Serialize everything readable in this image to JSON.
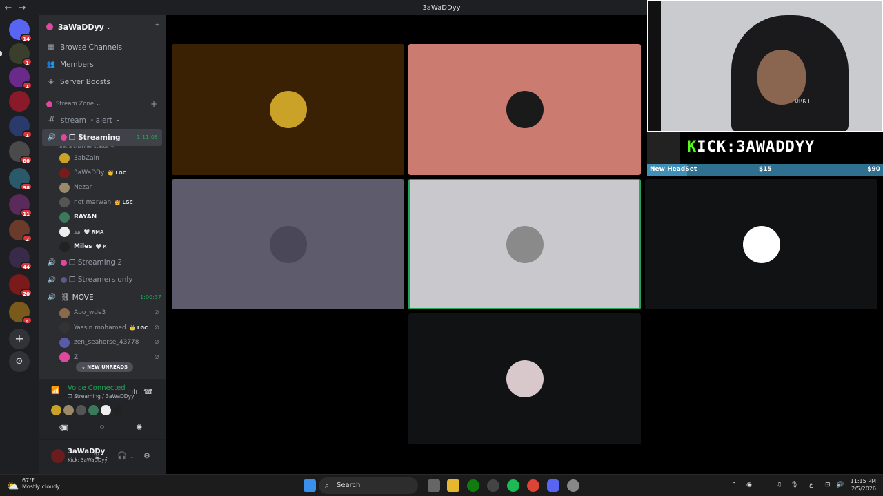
{
  "window": {
    "title": "3aWaDDyy",
    "back": "←",
    "forward": "→"
  },
  "rail": {
    "servers": [
      {
        "name": "home",
        "color": "#5865f2",
        "badge": "14",
        "y": 0
      },
      {
        "name": "s1",
        "color": "#3a3f2d",
        "badge": "1"
      },
      {
        "name": "s2",
        "color": "#6a2a8a",
        "badge": "1"
      },
      {
        "name": "s3",
        "color": "#8a1a2a",
        "badge": ""
      },
      {
        "name": "s4",
        "color": "#2a3a6a",
        "badge": "1"
      },
      {
        "name": "s5",
        "color": "#4a4a4a",
        "badge": "80"
      },
      {
        "name": "s6",
        "color": "#2a5a6a",
        "badge": "98"
      },
      {
        "name": "s7",
        "color": "#5a2a5a",
        "badge": "11"
      },
      {
        "name": "s8",
        "color": "#6a3a2a",
        "badge": "2"
      },
      {
        "name": "s9",
        "color": "#3a2a4a",
        "badge": "44"
      },
      {
        "name": "s10",
        "color": "#7a1a1a",
        "badge": "20"
      },
      {
        "name": "s11",
        "color": "#7a5a1a",
        "badge": "4"
      }
    ],
    "add_label": "+",
    "discover_label": "⊙"
  },
  "guild": {
    "name": "3aWaDDyy",
    "chevron": "⌄",
    "invite": "⁺"
  },
  "nav": [
    {
      "icon": "▦",
      "label": "Browse Channels"
    },
    {
      "icon": "👥",
      "label": "Members"
    },
    {
      "icon": "◈",
      "label": "Server Boosts"
    }
  ],
  "category": {
    "label": "Stream Zone",
    "chevron": "⌄",
    "add": "+"
  },
  "channels": {
    "alert": {
      "icon": "#",
      "label": "stream ・alert ┌"
    },
    "streaming": {
      "label": "❐ Streaming",
      "timer": "1:11:05",
      "status": "Set a channel status ✎"
    },
    "streaming2": {
      "label": "❐ Streaming 2"
    },
    "streamers_only": {
      "label": "❐ Streamers only"
    },
    "move": {
      "label": "⛓ MOVE",
      "timer": "1:00:37"
    }
  },
  "streaming_users": [
    {
      "name": "3abZain",
      "tag": "",
      "color": "#c9a227"
    },
    {
      "name": "3aWaDDy",
      "tag": "👑 LGC",
      "color": "#7a1a1a"
    },
    {
      "name": "Nezar",
      "tag": "",
      "color": "#9a8a6a"
    },
    {
      "name": "not marwan",
      "tag": "👑 LGC",
      "color": "#555"
    },
    {
      "name": "RAYAN",
      "tag": "",
      "color": "#3a7a5a"
    },
    {
      "name": "ﻣﺪ",
      "tag": "🤍 RMA",
      "color": "#eee"
    },
    {
      "name": "Miles",
      "tag": "🤍 Ꮶ",
      "color": "#222"
    }
  ],
  "move_users": [
    {
      "name": "Abo_wde3",
      "color": "#8a6a4a"
    },
    {
      "name": "Yassin mohamed",
      "tag": "👑 LGC",
      "color": "#333"
    },
    {
      "name": "zen_seahorse_43778",
      "color": "#5a5aaa"
    },
    {
      "name": "Z",
      "color": "#e0479e"
    }
  ],
  "mute_icon": "⊘",
  "new_unreads": "⌄ NEW UNREADS",
  "voice": {
    "title": "Voice Connected",
    "subtitle": "❐ Streaming / 3aWaDDyy",
    "signal": "📶",
    "soundboard": "ılılı",
    "disconnect": "☎",
    "avatars": [
      "#c9a227",
      "#9a8a6a",
      "#555",
      "#3a7a5a",
      "#eee",
      "#222"
    ],
    "controls": [
      "⊘",
      "▣",
      "⁘",
      "✺"
    ]
  },
  "user": {
    "name": "3aWaDDy",
    "status": "Kick: 3aWaDDyy",
    "mic": "🎙",
    "headset": "🎧",
    "settings": "⚙",
    "chev": "⌄"
  },
  "tiles": [
    {
      "bg": "#3b2103",
      "av": "#c9a227",
      "speaking": false
    },
    {
      "bg": "#cb7b70",
      "av": "#1a1a1a",
      "speaking": false
    },
    {
      "bg": "#5e5b6d",
      "av": "#4a4758",
      "speaking": false
    },
    {
      "bg": "#c9c8cd",
      "av": "#8a8a8a",
      "speaking": true
    },
    {
      "bg": "#111214",
      "av": "#ffffff",
      "speaking": false
    },
    {
      "bg": "#111214",
      "av": "#d8c8cc",
      "speaking": false
    }
  ],
  "overlay": {
    "kick_prefix": "K",
    "kick_text": "ICK:3AWADDYY",
    "goal_name": "New HeadSet",
    "goal_current": "$15",
    "goal_target": "$90",
    "goal_progress": 0.17,
    "cam_text": "URK I"
  },
  "taskbar": {
    "weather_temp": "67°F",
    "weather_desc": "Mostly cloudy",
    "search": "Search",
    "time": "11:15 PM",
    "date": "2/5/2026",
    "tray": [
      "⌃",
      "◉",
      "♫",
      "🎙",
      "ع",
      "⊡",
      "🔊"
    ]
  }
}
